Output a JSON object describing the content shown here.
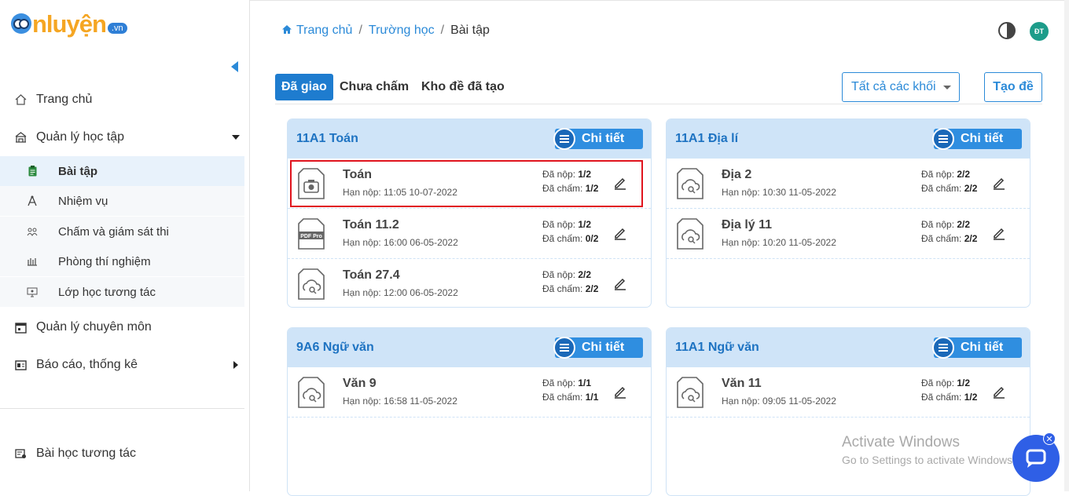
{
  "logo": {
    "word": "nluyện",
    "tld": ".vn"
  },
  "sidebar": {
    "items": [
      {
        "label": "Trang chủ",
        "icon": "home-icon"
      },
      {
        "label": "Quản lý học tập",
        "icon": "school-icon"
      },
      {
        "label": "Quản lý chuyên môn",
        "icon": "calendar-icon"
      },
      {
        "label": "Báo cáo, thống kê",
        "icon": "report-icon"
      },
      {
        "label": "Bài học tương tác",
        "icon": "lesson-icon"
      }
    ],
    "subitems": [
      {
        "label": "Bài tập",
        "icon": "clipboard-icon"
      },
      {
        "label": "Nhiệm vụ",
        "icon": "compass-icon"
      },
      {
        "label": "Chấm và giám sát thi",
        "icon": "users-icon"
      },
      {
        "label": "Phòng thí nghiệm",
        "icon": "lab-icon"
      },
      {
        "label": "Lớp học tương tác",
        "icon": "screen-icon"
      }
    ]
  },
  "breadcrumb": {
    "home": "Trang chủ",
    "school": "Trường học",
    "current": "Bài tập"
  },
  "avatar": "ĐT",
  "tabs": [
    {
      "label": "Đã giao",
      "active": true
    },
    {
      "label": "Chưa chấm",
      "active": false
    },
    {
      "label": "Kho đề đã tạo",
      "active": false
    }
  ],
  "filter": {
    "selected": "Tất cả các khối"
  },
  "create_label": "Tạo đề",
  "labels": {
    "detail": "Chi tiết",
    "submitted": "Đã nộp:",
    "graded": "Đã chấm:"
  },
  "cards": [
    {
      "title": "11A1 Toán",
      "rows": [
        {
          "name": "Toán",
          "due": "Hạn nộp: 11:05 10-07-2022",
          "submitted": "1/2",
          "graded": "1/2",
          "icon": "camera-file-icon"
        },
        {
          "name": "Toán 11.2",
          "due": "Hạn nộp: 16:00 06-05-2022",
          "submitted": "1/2",
          "graded": "0/2",
          "icon": "pdf-file-icon",
          "pdf_text": "PDF Pro"
        },
        {
          "name": "Toán 27.4",
          "due": "Hạn nộp: 12:00 06-05-2022",
          "submitted": "2/2",
          "graded": "2/2",
          "icon": "cloud-file-icon"
        }
      ]
    },
    {
      "title": "11A1 Địa lí",
      "rows": [
        {
          "name": "Địa 2",
          "due": "Hạn nộp: 10:30 11-05-2022",
          "submitted": "2/2",
          "graded": "2/2",
          "icon": "cloud-file-icon"
        },
        {
          "name": "Địa lý 11",
          "due": "Hạn nộp: 10:20 11-05-2022",
          "submitted": "2/2",
          "graded": "2/2",
          "icon": "cloud-file-icon"
        }
      ]
    },
    {
      "title": "9A6 Ngữ văn",
      "rows": [
        {
          "name": "Văn 9",
          "due": "Hạn nộp: 16:58 11-05-2022",
          "submitted": "1/1",
          "graded": "1/1",
          "icon": "cloud-file-icon"
        }
      ]
    },
    {
      "title": "11A1 Ngữ văn",
      "rows": [
        {
          "name": "Văn 11",
          "due": "Hạn nộp: 09:05 11-05-2022",
          "submitted": "1/2",
          "graded": "1/2",
          "icon": "cloud-file-icon"
        }
      ]
    }
  ],
  "watermark": {
    "line1": "Activate Windows",
    "line2": "Go to Settings to activate Windows."
  },
  "colors": {
    "accent": "#2b8ad8",
    "card_header": "#cfe4f8",
    "highlight": "#e0141e"
  }
}
